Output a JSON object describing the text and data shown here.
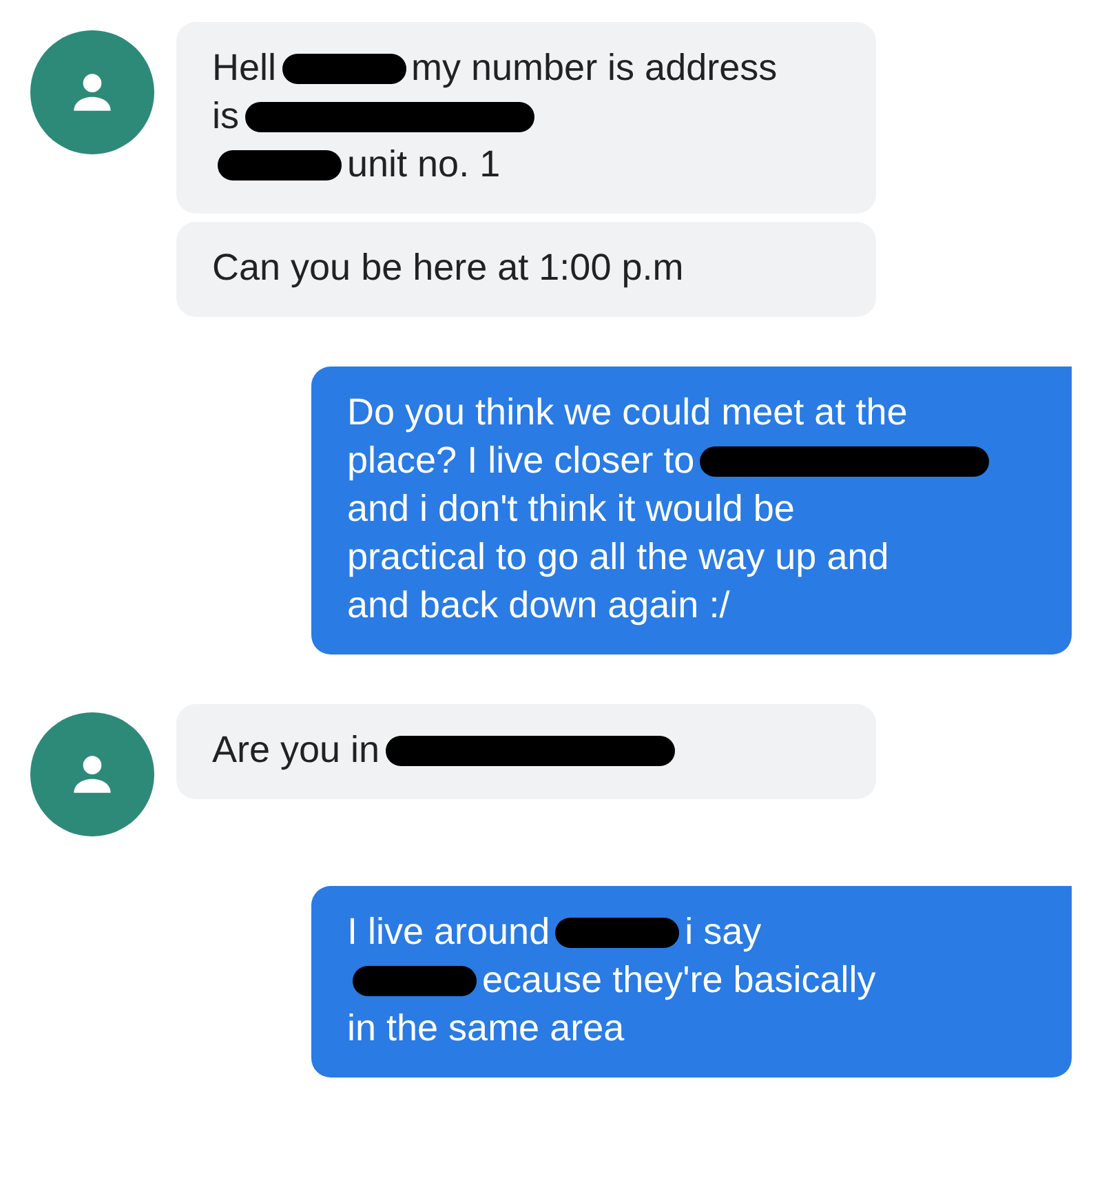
{
  "messages": [
    {
      "kind": "incoming",
      "avatar": true,
      "lines": [
        [
          {
            "kind": "text",
            "text": "Hell"
          },
          {
            "kind": "redaction"
          },
          {
            "kind": "text",
            "text": "my number is address"
          }
        ],
        [
          {
            "kind": "text",
            "text": "is"
          },
          {
            "kind": "redaction"
          }
        ],
        [
          {
            "kind": "redaction"
          },
          {
            "kind": "text",
            "text": "unit no. 1"
          }
        ]
      ]
    },
    {
      "kind": "incoming",
      "avatar": false,
      "lines": [
        [
          {
            "kind": "text",
            "text": "Can you be here at 1:00 p.m"
          }
        ]
      ]
    },
    {
      "kind": "outgoing",
      "avatar": false,
      "lines": [
        [
          {
            "kind": "text",
            "text": "Do you think we could meet at the"
          }
        ],
        [
          {
            "kind": "text",
            "text": "place? I live closer to"
          },
          {
            "kind": "redaction"
          }
        ],
        [
          {
            "kind": "text",
            "text": "and i don't think it would be"
          }
        ],
        [
          {
            "kind": "text",
            "text": "practical to go all the way up and"
          }
        ],
        [
          {
            "kind": "text",
            "text": "and back down again :/"
          }
        ]
      ]
    },
    {
      "kind": "incoming",
      "avatar": true,
      "lines": [
        [
          {
            "kind": "text",
            "text": "Are you in"
          },
          {
            "kind": "redaction"
          }
        ]
      ]
    },
    {
      "kind": "outgoing",
      "avatar": false,
      "lines": [
        [
          {
            "kind": "text",
            "text": "I live around"
          },
          {
            "kind": "redaction"
          },
          {
            "kind": "text",
            "text": "i say"
          }
        ],
        [
          {
            "kind": "redaction"
          },
          {
            "kind": "text",
            "text": "ecause they're basically"
          }
        ],
        [
          {
            "kind": "text",
            "text": "in the same area"
          }
        ]
      ]
    }
  ]
}
